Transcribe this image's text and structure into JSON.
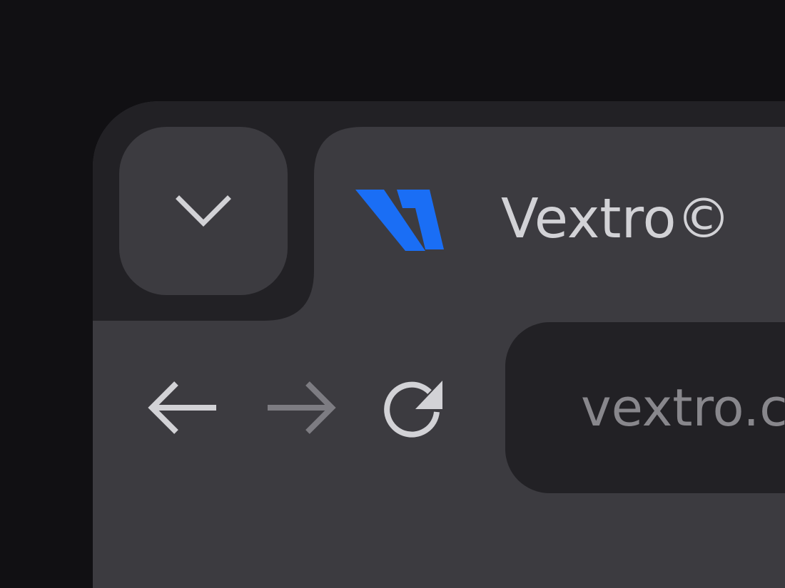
{
  "tab": {
    "title": "Vextro©",
    "logo_icon": "vextro-logo",
    "logo_color": "#1a6ef5"
  },
  "tab_menu": {
    "icon": "chevron-down-icon"
  },
  "nav": {
    "back_icon": "arrow-left-icon",
    "forward_icon": "arrow-right-icon",
    "reload_icon": "reload-icon"
  },
  "address_bar": {
    "value": "vextro.c"
  },
  "colors": {
    "background": "#111013",
    "tab_strip": "#222125",
    "toolbar": "#3c3b40",
    "text_primary": "#d2d2d6",
    "text_muted": "#88878c"
  }
}
